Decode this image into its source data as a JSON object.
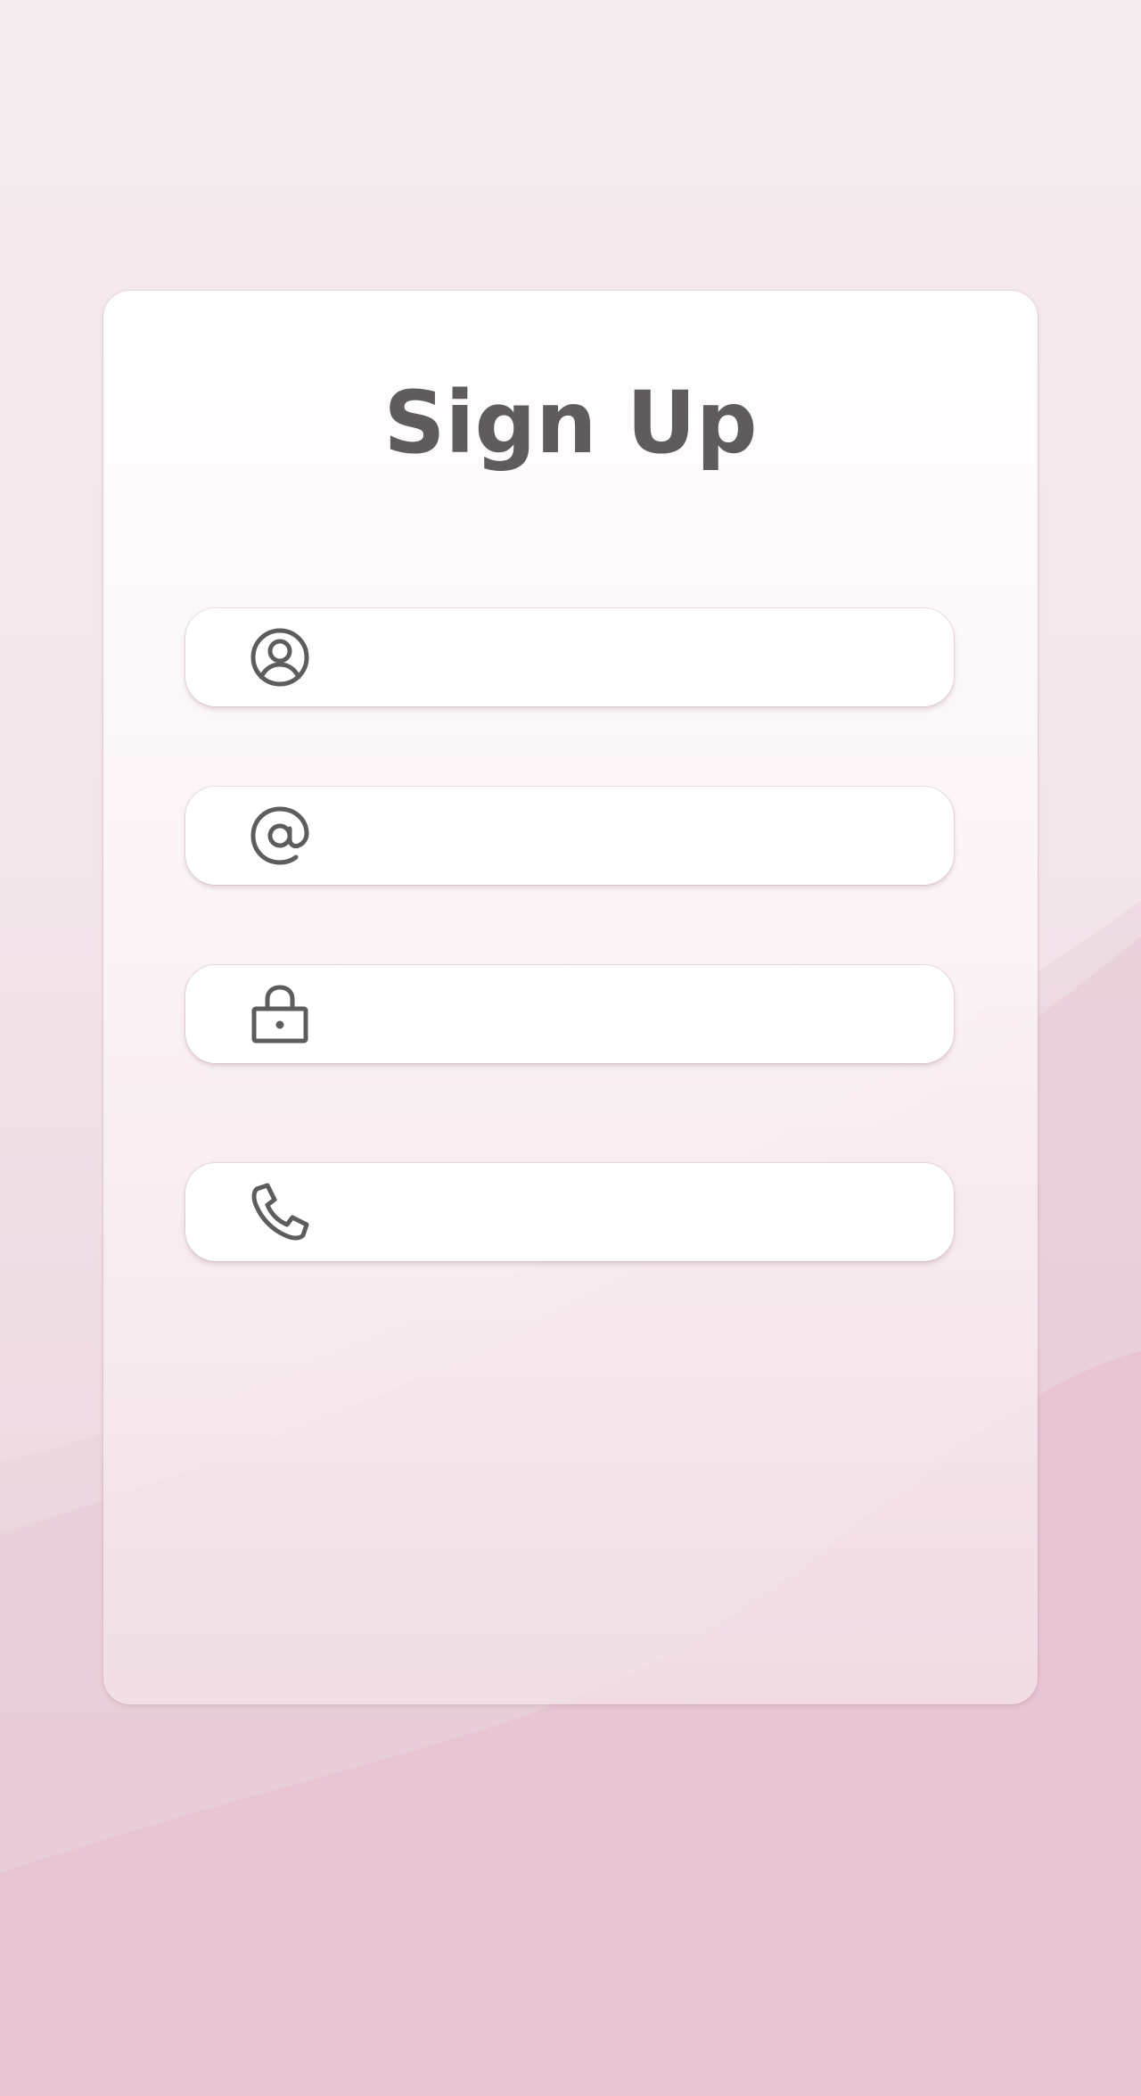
{
  "form": {
    "title": "Sign Up",
    "fields": [
      {
        "icon": "user-circle-icon",
        "value": "",
        "placeholder": ""
      },
      {
        "icon": "at-sign-icon",
        "value": "",
        "placeholder": ""
      },
      {
        "icon": "lock-icon",
        "value": "",
        "placeholder": ""
      },
      {
        "icon": "phone-icon",
        "value": "",
        "placeholder": ""
      }
    ]
  },
  "colors": {
    "text": "#5f5c5e",
    "card": "#ffffff",
    "background": "#f3e6eb",
    "wave": "#e6c3d1"
  }
}
